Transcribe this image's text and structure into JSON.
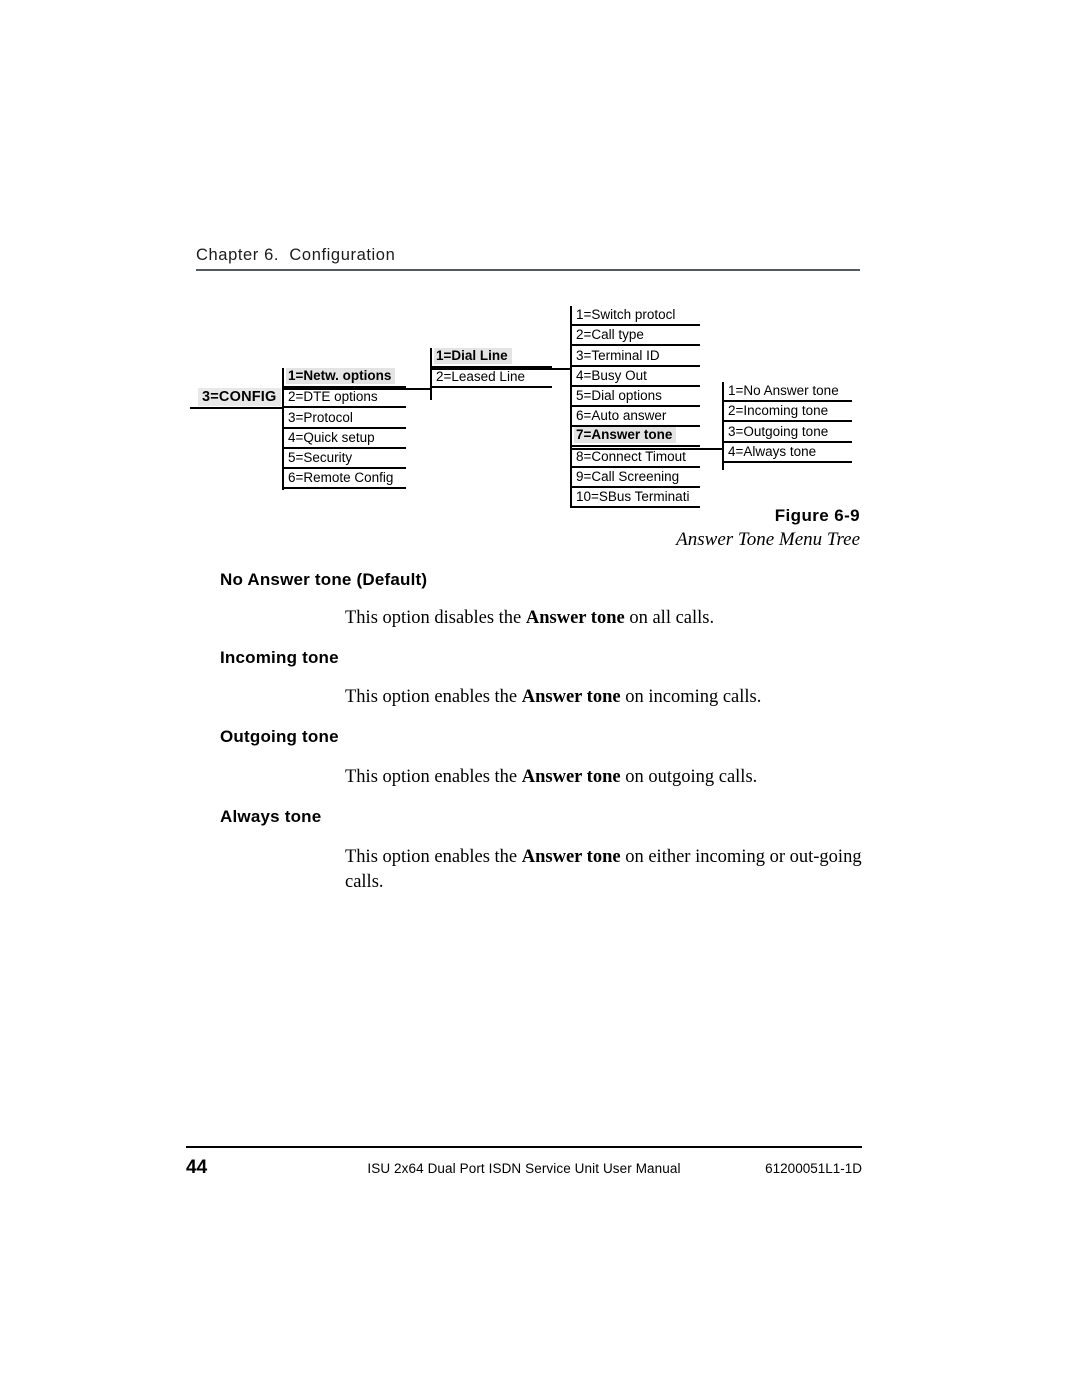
{
  "header": {
    "chapter": "Chapter 6.  Configuration"
  },
  "figure": {
    "number": "Figure 6-9",
    "title": "Answer Tone Menu Tree",
    "root": {
      "label": "3=CONFIG",
      "highlighted": true
    },
    "columns": [
      {
        "name": "config-menu",
        "items": [
          {
            "label": "1=Netw. options",
            "highlighted": true
          },
          {
            "label": "2=DTE options",
            "highlighted": false
          },
          {
            "label": "3=Protocol",
            "highlighted": false
          },
          {
            "label": "4=Quick setup",
            "highlighted": false
          },
          {
            "label": "5=Security",
            "highlighted": false
          },
          {
            "label": "6=Remote Config",
            "highlighted": false
          }
        ]
      },
      {
        "name": "network-options-menu",
        "items": [
          {
            "label": "1=Dial Line",
            "highlighted": true
          },
          {
            "label": "2=Leased Line",
            "highlighted": false
          }
        ]
      },
      {
        "name": "dial-line-menu",
        "items": [
          {
            "label": "1=Switch protocl",
            "highlighted": false
          },
          {
            "label": "2=Call type",
            "highlighted": false
          },
          {
            "label": "3=Terminal ID",
            "highlighted": false
          },
          {
            "label": "4=Busy Out",
            "highlighted": false
          },
          {
            "label": "5=Dial options",
            "highlighted": false
          },
          {
            "label": "6=Auto answer",
            "highlighted": false
          },
          {
            "label": "7=Answer tone",
            "highlighted": true
          },
          {
            "label": "8=Connect Timout",
            "highlighted": false
          },
          {
            "label": "9=Call Screening",
            "highlighted": false
          },
          {
            "label": "10=SBus Terminati",
            "highlighted": false
          }
        ]
      },
      {
        "name": "answer-tone-menu",
        "items": [
          {
            "label": "1=No Answer tone",
            "highlighted": false
          },
          {
            "label": "2=Incoming tone",
            "highlighted": false
          },
          {
            "label": "3=Outgoing tone",
            "highlighted": false
          },
          {
            "label": "4=Always tone",
            "highlighted": false
          }
        ]
      }
    ]
  },
  "sections": [
    {
      "heading": "No Answer tone (Default)",
      "body_pre": "This option disables the ",
      "body_bold": "Answer tone",
      "body_post": " on all calls."
    },
    {
      "heading": "Incoming tone",
      "body_pre": "This option enables the ",
      "body_bold": "Answer tone",
      "body_post": " on incoming calls."
    },
    {
      "heading": "Outgoing tone",
      "body_pre": "This option enables the ",
      "body_bold": "Answer tone",
      "body_post": " on outgoing calls."
    },
    {
      "heading": "Always tone",
      "body_pre": "This option enables the ",
      "body_bold": "Answer tone",
      "body_post": " on either incoming or out-going calls."
    }
  ],
  "footer": {
    "page_number": "44",
    "manual_title": "ISU 2x64 Dual Port ISDN Service Unit User Manual",
    "doc_id": "61200051L1-1D"
  }
}
